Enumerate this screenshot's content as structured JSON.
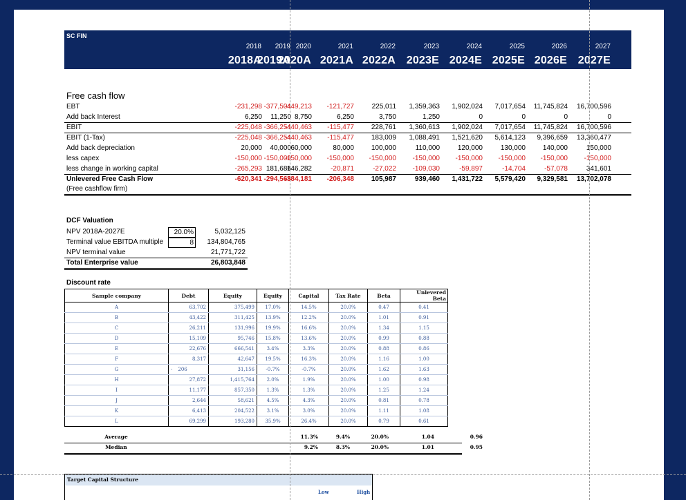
{
  "header": {
    "title": "SC FIN",
    "years": [
      "2018",
      "2019",
      "2020",
      "2021",
      "2022",
      "2023",
      "2024",
      "2025",
      "2026",
      "2027"
    ],
    "periods": [
      "2018A",
      "2019A",
      "2020A",
      "2021A",
      "2022A",
      "2023E",
      "2024E",
      "2025E",
      "2026E",
      "2027E"
    ]
  },
  "fcf": {
    "title": "Free cash flow",
    "rows": [
      {
        "label": "EBT",
        "values": [
          "-231,298",
          "-377,504",
          "-449,213",
          "-121,727",
          "225,011",
          "1,359,363",
          "1,902,024",
          "7,017,654",
          "11,745,824",
          "16,700,596"
        ]
      },
      {
        "label": "Add back Interest",
        "values": [
          "6,250",
          "11,250",
          "8,750",
          "6,250",
          "3,750",
          "1,250",
          "0",
          "0",
          "0",
          "0"
        ]
      },
      {
        "label": "EBIT",
        "values": [
          "-225,048",
          "-366,254",
          "-440,463",
          "-115,477",
          "228,761",
          "1,360,613",
          "1,902,024",
          "7,017,654",
          "11,745,824",
          "16,700,596"
        ]
      },
      {
        "label": "EBIT (1-Tax)",
        "values": [
          "-225,048",
          "-366,254",
          "-440,463",
          "-115,477",
          "183,009",
          "1,088,491",
          "1,521,620",
          "5,614,123",
          "9,396,659",
          "13,360,477"
        ]
      },
      {
        "label": "Add back depreciation",
        "values": [
          "20,000",
          "40,000",
          "60,000",
          "80,000",
          "100,000",
          "110,000",
          "120,000",
          "130,000",
          "140,000",
          "150,000"
        ]
      },
      {
        "label": "less capex",
        "values": [
          "-150,000",
          "-150,000",
          "-150,000",
          "-150,000",
          "-150,000",
          "-150,000",
          "-150,000",
          "-150,000",
          "-150,000",
          "-150,000"
        ]
      },
      {
        "label": "less change in working capital",
        "values": [
          "-265,293",
          "181,686",
          "146,282",
          "-20,871",
          "-27,022",
          "-109,030",
          "-59,897",
          "-14,704",
          "-57,078",
          "341,601"
        ]
      },
      {
        "label": "Unlevered Free Cash Flow",
        "values": [
          "-620,341",
          "-294,568",
          "-384,181",
          "-206,348",
          "105,987",
          "939,460",
          "1,431,722",
          "5,579,420",
          "9,329,581",
          "13,702,078"
        ]
      }
    ],
    "note": "(Free cashflow firm)"
  },
  "dcf": {
    "title": "DCF Valuation",
    "npv_label": "NPV 2018A-2027E",
    "npv_rate": "20.0%",
    "npv_value": "5,032,125",
    "tv_label": "Terminal value EBITDA multiple",
    "tv_multiple": "8",
    "tv_value": "134,804,765",
    "npv_tv_label": "NPV terminal value",
    "npv_tv_value": "21,771,722",
    "tev_label": "Total Enterprise value",
    "tev_value": "26,803,848"
  },
  "discount": {
    "title": "Discount rate",
    "columns": [
      "Sample company",
      "Debt",
      "Equity",
      "Equity",
      "Capital",
      "Tax Rate",
      "Beta",
      "Unlevered Beta"
    ],
    "rows": [
      [
        "A",
        "63,702",
        "375,499",
        "17.0%",
        "14.5%",
        "20.0%",
        "0.47",
        "0.41"
      ],
      [
        "B",
        "43,422",
        "311,425",
        "13.9%",
        "12.2%",
        "20.0%",
        "1.01",
        "0.91"
      ],
      [
        "C",
        "26,211",
        "131,996",
        "19.9%",
        "16.6%",
        "20.0%",
        "1.34",
        "1.15"
      ],
      [
        "D",
        "15,109",
        "95,746",
        "15.8%",
        "13.6%",
        "20.0%",
        "0.99",
        "0.88"
      ],
      [
        "E",
        "22,676",
        "666,541",
        "3.4%",
        "3.3%",
        "20.0%",
        "0.88",
        "0.86"
      ],
      [
        "F",
        "8,317",
        "42,647",
        "19.5%",
        "16.3%",
        "20.0%",
        "1.16",
        "1.00"
      ],
      [
        "G",
        "206",
        "31,156",
        "-0.7%",
        "-0.7%",
        "20.0%",
        "1.62",
        "1.63"
      ],
      [
        "H",
        "27,872",
        "1,415,764",
        "2.0%",
        "1.9%",
        "20.0%",
        "1.00",
        "0.98"
      ],
      [
        "I",
        "11,177",
        "857,350",
        "1.3%",
        "1.3%",
        "20.0%",
        "1.25",
        "1.24"
      ],
      [
        "J",
        "2,644",
        "58,621",
        "4.5%",
        "4.3%",
        "20.0%",
        "0.81",
        "0.78"
      ],
      [
        "K",
        "6,413",
        "204,522",
        "3.1%",
        "3.0%",
        "20.0%",
        "1.11",
        "1.08"
      ],
      [
        "L",
        "69,299",
        "193,280",
        "35.9%",
        "26.4%",
        "20.0%",
        "0.79",
        "0.61"
      ]
    ],
    "g_debt_prefix": "-",
    "average": {
      "label": "Average",
      "values": [
        "11.3%",
        "9.4%",
        "20.0%",
        "1.04",
        "0.96"
      ]
    },
    "median": {
      "label": "Median",
      "values": [
        "9.2%",
        "8.3%",
        "20.0%",
        "1.01",
        "0.95"
      ]
    }
  },
  "target": {
    "title": "Target Capital Structure",
    "low": "Low",
    "high": "High"
  },
  "colors": {
    "navy": "#0d2761",
    "negative": "#d32020",
    "table_text": "#3a5a9a",
    "tcs_fill": "#dbe6f3"
  }
}
